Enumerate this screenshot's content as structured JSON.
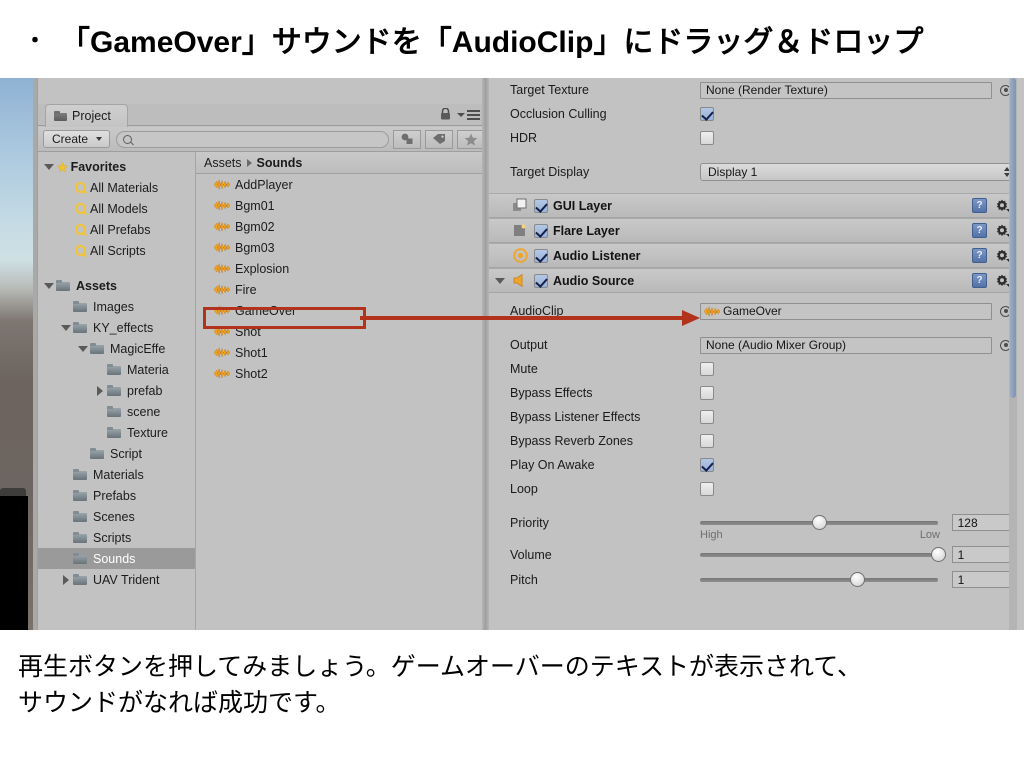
{
  "slide": {
    "bullet": "・",
    "heading": "「GameOver」サウンドを「AudioClip」にドラッグ＆ドロップ",
    "caption_line1": "再生ボタンを押してみましょう。ゲームオーバーのテキストが表示されて、",
    "caption_line2": "サウンドがなれば成功です。"
  },
  "colors": {
    "annotation": "#b3321c",
    "panel_bg": "#c2c2c2",
    "selection": "#9a9a9a",
    "audio_icon": "#f0a429",
    "checkbox_on": "#9ab3d8"
  },
  "project_panel": {
    "tab_label": "Project",
    "tab_icon": "folder-icon",
    "lock_icon": "lock-icon",
    "menu_icon": "panel-menu-icon",
    "create_label": "Create",
    "search_placeholder": "",
    "search_value": "",
    "search_icon": "search-icon",
    "filter_buttons": [
      "shapes-filter-icon",
      "label-filter-icon",
      "favorite-filter-icon"
    ],
    "tree": [
      {
        "label": "Favorites",
        "icon": "star-icon",
        "depth": 0,
        "twisty": "down",
        "bold": true,
        "selected": false
      },
      {
        "label": "All Materials",
        "icon": "search-icon",
        "depth": 1,
        "twisty": "none",
        "bold": false,
        "selected": false
      },
      {
        "label": "All Models",
        "icon": "search-icon",
        "depth": 1,
        "twisty": "none",
        "bold": false,
        "selected": false
      },
      {
        "label": "All Prefabs",
        "icon": "search-icon",
        "depth": 1,
        "twisty": "none",
        "bold": false,
        "selected": false
      },
      {
        "label": "All Scripts",
        "icon": "search-icon",
        "depth": 1,
        "twisty": "none",
        "bold": false,
        "selected": false
      },
      {
        "label": "",
        "icon": "none",
        "depth": 0,
        "twisty": "none",
        "bold": false,
        "selected": false
      },
      {
        "label": "Assets",
        "icon": "folder-icon",
        "depth": 0,
        "twisty": "down",
        "bold": true,
        "selected": false
      },
      {
        "label": "Images",
        "icon": "folder-icon",
        "depth": 1,
        "twisty": "none",
        "bold": false,
        "selected": false
      },
      {
        "label": "KY_effects",
        "icon": "folder-icon",
        "depth": 1,
        "twisty": "down",
        "bold": false,
        "selected": false
      },
      {
        "label": "MagicEffe",
        "icon": "folder-icon",
        "depth": 2,
        "twisty": "down",
        "bold": false,
        "selected": false
      },
      {
        "label": "Materia",
        "icon": "folder-icon",
        "depth": 3,
        "twisty": "none",
        "bold": false,
        "selected": false
      },
      {
        "label": "prefab",
        "icon": "folder-icon",
        "depth": 3,
        "twisty": "right",
        "bold": false,
        "selected": false
      },
      {
        "label": "scene",
        "icon": "folder-icon",
        "depth": 3,
        "twisty": "none",
        "bold": false,
        "selected": false
      },
      {
        "label": "Texture",
        "icon": "folder-icon",
        "depth": 3,
        "twisty": "none",
        "bold": false,
        "selected": false
      },
      {
        "label": "Script",
        "icon": "folder-icon",
        "depth": 2,
        "twisty": "none",
        "bold": false,
        "selected": false
      },
      {
        "label": "Materials",
        "icon": "folder-icon",
        "depth": 1,
        "twisty": "none",
        "bold": false,
        "selected": false
      },
      {
        "label": "Prefabs",
        "icon": "folder-icon",
        "depth": 1,
        "twisty": "none",
        "bold": false,
        "selected": false
      },
      {
        "label": "Scenes",
        "icon": "folder-icon",
        "depth": 1,
        "twisty": "none",
        "bold": false,
        "selected": false
      },
      {
        "label": "Scripts",
        "icon": "folder-icon",
        "depth": 1,
        "twisty": "none",
        "bold": false,
        "selected": false
      },
      {
        "label": "Sounds",
        "icon": "folder-icon",
        "depth": 1,
        "twisty": "none",
        "bold": false,
        "selected": true
      },
      {
        "label": "UAV Trident",
        "icon": "folder-icon",
        "depth": 1,
        "twisty": "right",
        "bold": false,
        "selected": false
      }
    ],
    "breadcrumb": {
      "root": "Assets",
      "current": "Sounds"
    },
    "assets": [
      {
        "name": "AddPlayer",
        "icon": "audio-clip-icon",
        "highlighted": false
      },
      {
        "name": "Bgm01",
        "icon": "audio-clip-icon",
        "highlighted": false
      },
      {
        "name": "Bgm02",
        "icon": "audio-clip-icon",
        "highlighted": false
      },
      {
        "name": "Bgm03",
        "icon": "audio-clip-icon",
        "highlighted": false
      },
      {
        "name": "Explosion",
        "icon": "audio-clip-icon",
        "highlighted": false
      },
      {
        "name": "Fire",
        "icon": "audio-clip-icon",
        "highlighted": false
      },
      {
        "name": "GameOver",
        "icon": "audio-clip-icon",
        "highlighted": true
      },
      {
        "name": "Shot",
        "icon": "audio-clip-icon",
        "highlighted": false
      },
      {
        "name": "Shot1",
        "icon": "audio-clip-icon",
        "highlighted": false
      },
      {
        "name": "Shot2",
        "icon": "audio-clip-icon",
        "highlighted": false
      }
    ]
  },
  "inspector": {
    "camera_fields": [
      {
        "label": "Target Texture",
        "type": "object",
        "value": "None (Render Texture)"
      },
      {
        "label": "Occlusion Culling",
        "type": "checkbox",
        "checked": true
      },
      {
        "label": "HDR",
        "type": "checkbox",
        "checked": false
      }
    ],
    "target_display": {
      "label": "Target Display",
      "value": "Display 1"
    },
    "components": [
      {
        "name": "GUI Layer",
        "icon": "gui-layer-icon",
        "enabled": true,
        "foldout": "none",
        "help_icon": "help-icon",
        "gear_icon": "gear-icon"
      },
      {
        "name": "Flare Layer",
        "icon": "flare-layer-icon",
        "enabled": true,
        "foldout": "none",
        "help_icon": "help-icon",
        "gear_icon": "gear-icon"
      },
      {
        "name": "Audio Listener",
        "icon": "audio-listener-icon",
        "enabled": true,
        "foldout": "none",
        "help_icon": "help-icon",
        "gear_icon": "gear-icon"
      },
      {
        "name": "Audio Source",
        "icon": "audio-source-icon",
        "enabled": true,
        "foldout": "down",
        "help_icon": "help-icon",
        "gear_icon": "gear-icon"
      }
    ],
    "audio_source": {
      "audio_clip": {
        "label": "AudioClip",
        "value": "GameOver",
        "icon": "audio-clip-icon"
      },
      "output": {
        "label": "Output",
        "value": "None (Audio Mixer Group)"
      },
      "toggles": [
        {
          "label": "Mute",
          "checked": false
        },
        {
          "label": "Bypass Effects",
          "checked": false
        },
        {
          "label": "Bypass Listener Effects",
          "checked": false
        },
        {
          "label": "Bypass Reverb Zones",
          "checked": false
        },
        {
          "label": "Play On Awake",
          "checked": true
        },
        {
          "label": "Loop",
          "checked": false
        }
      ],
      "sliders": [
        {
          "label": "Priority",
          "value": "128",
          "fraction": 0.5,
          "left_label": "High",
          "right_label": "Low"
        },
        {
          "label": "Volume",
          "value": "1",
          "fraction": 1.0,
          "left_label": "",
          "right_label": ""
        },
        {
          "label": "Pitch",
          "value": "1",
          "fraction": 0.66,
          "left_label": "",
          "right_label": ""
        }
      ]
    },
    "scrollbar": "inspector-scrollbar"
  }
}
